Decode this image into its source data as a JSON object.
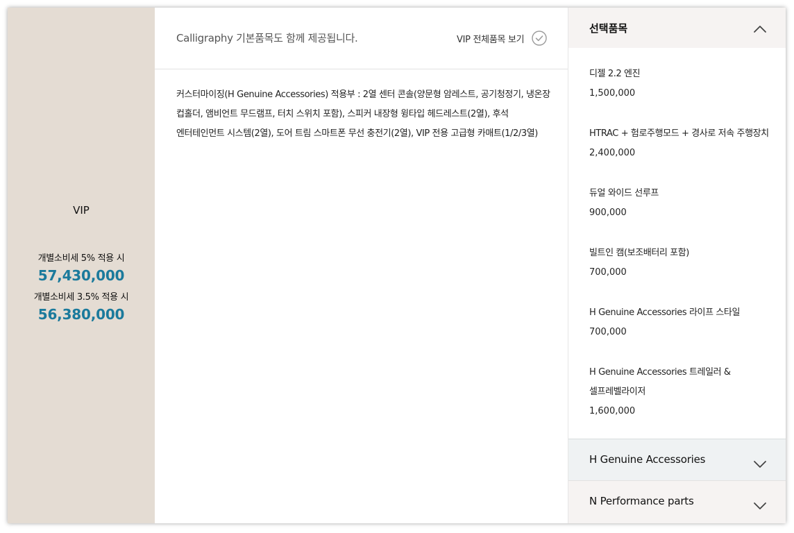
{
  "trim": {
    "name": "VIP",
    "price_5_label": "개별소비세 5% 적용 시",
    "price_5_value": "57,430,000",
    "price_35_label": "개별소비세 3.5% 적용 시",
    "price_35_value": "56,380,000"
  },
  "middle": {
    "title": "Calligraphy 기본품목도 함께 제공됩니다.",
    "view_all_label": "VIP 전체품목 보기",
    "description_lines": [
      "커스터마이징(H Genuine Accessories) 적용부 : 2열 센터 콘솔(양문형 암레스트, 공기청정기, 냉온장",
      "컵홀더, 앰비언트 무드램프, 터치 스위치 포함), 스피커 내장형 윙타입 헤드레스트(2열), 후석",
      "엔터테인먼트 시스템(2열), 도어 트림 스마트폰 무선 충전기(2열), VIP 전용 고급형 카매트(1/2/3열)"
    ]
  },
  "selected": {
    "title": "선택품목",
    "items": [
      {
        "name": "디젤 2.2 엔진",
        "price": "1,500,000"
      },
      {
        "name": "HTRAC + 험로주행모드 + 경사로 저속 주행장치",
        "price": "2,400,000"
      },
      {
        "name": "듀얼 와이드 선루프",
        "price": "900,000"
      },
      {
        "name": "빌트인 캠(보조배터리 포함)",
        "price": "700,000"
      },
      {
        "name": "H Genuine Accessories 라이프 스타일",
        "price": "700,000"
      },
      {
        "name": "H Genuine Accessories 트레일러 &",
        "name2": "셀프레벨라이저",
        "price": "1,600,000"
      }
    ]
  },
  "accordions": [
    {
      "label": "H Genuine Accessories"
    },
    {
      "label": "N Performance parts"
    }
  ],
  "colors": {
    "trim_bg": "#e4dcd3",
    "price_accent": "#1b7a9c",
    "header_bg": "#f6f3f2",
    "accordion_bg": "#eff2f3"
  },
  "icons": {
    "view_all": "check-circle-icon",
    "collapse": "chevron-up-icon",
    "expand": "chevron-down-icon"
  }
}
